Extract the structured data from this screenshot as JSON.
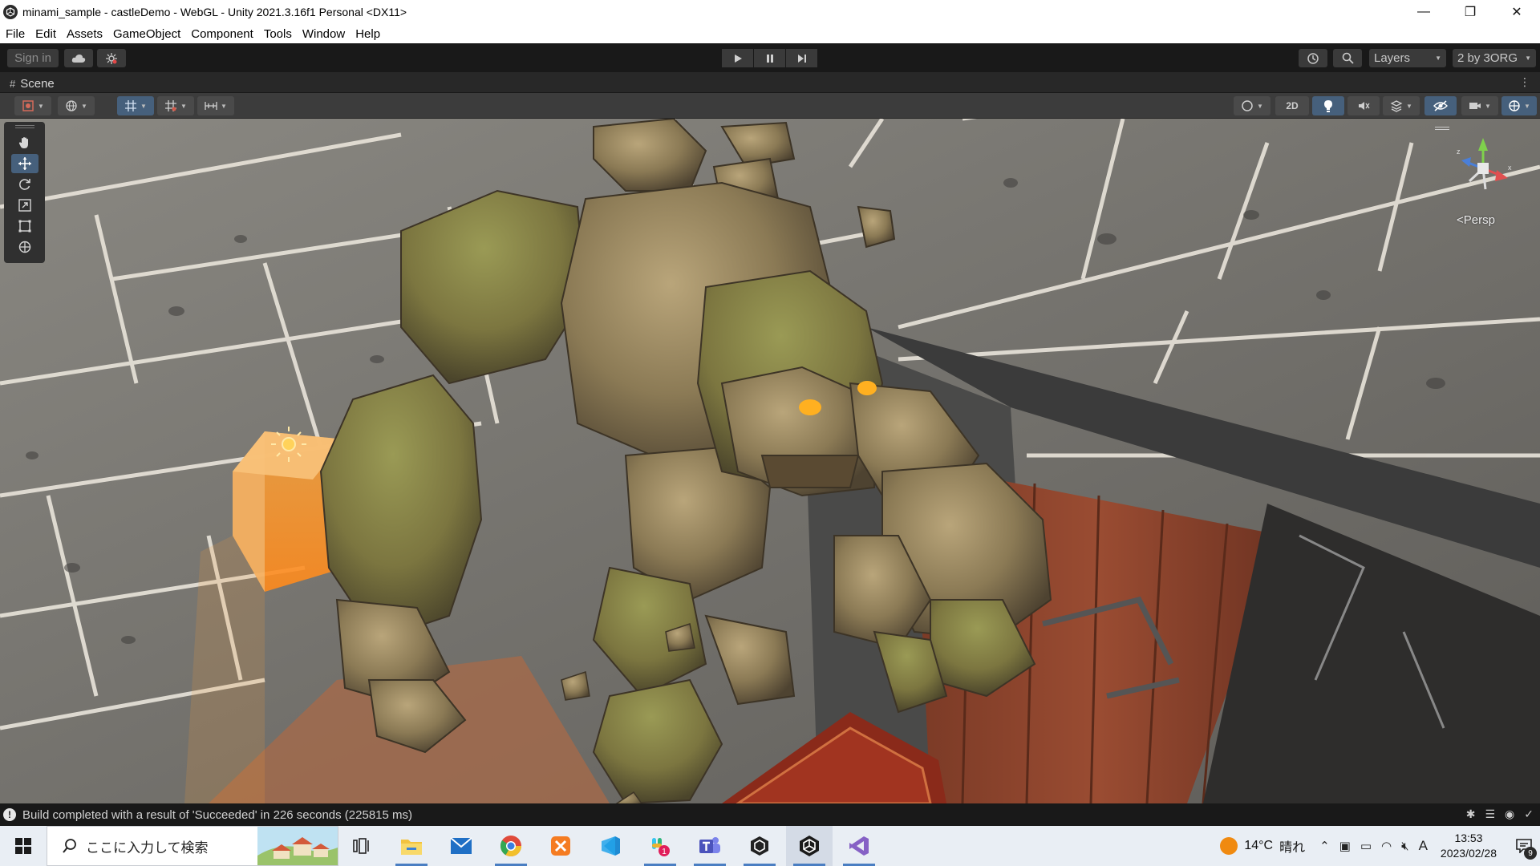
{
  "window": {
    "title": "minami_sample - castleDemo - WebGL - Unity 2021.3.16f1 Personal <DX11>",
    "minimize_glyph": "—",
    "restore_glyph": "❐",
    "close_glyph": "✕"
  },
  "menu": [
    "File",
    "Edit",
    "Assets",
    "GameObject",
    "Component",
    "Tools",
    "Window",
    "Help"
  ],
  "toolbar": {
    "signin_label": "Sign in",
    "layers_label": "Layers",
    "layout_label": "2 by 3ORG"
  },
  "scene": {
    "tab_label": "Scene",
    "mode_2d_label": "2D",
    "persp_label": "Persp"
  },
  "status": {
    "message": "Build completed with a result of 'Succeeded' in 226 seconds (225815 ms)"
  },
  "taskbar": {
    "search_placeholder": "ここに入力して検索",
    "teams_badge": "1",
    "weather_temp": "14°C",
    "weather_desc": "晴れ",
    "ime_label": "A",
    "time": "13:53",
    "date": "2023/02/28",
    "notification_count": "9"
  },
  "colors": {
    "editor_bg": "#191919",
    "tool_active": "#46607c",
    "taskbar_bg": "#e9eef4",
    "light_gizmo": "#ff8a1c"
  }
}
